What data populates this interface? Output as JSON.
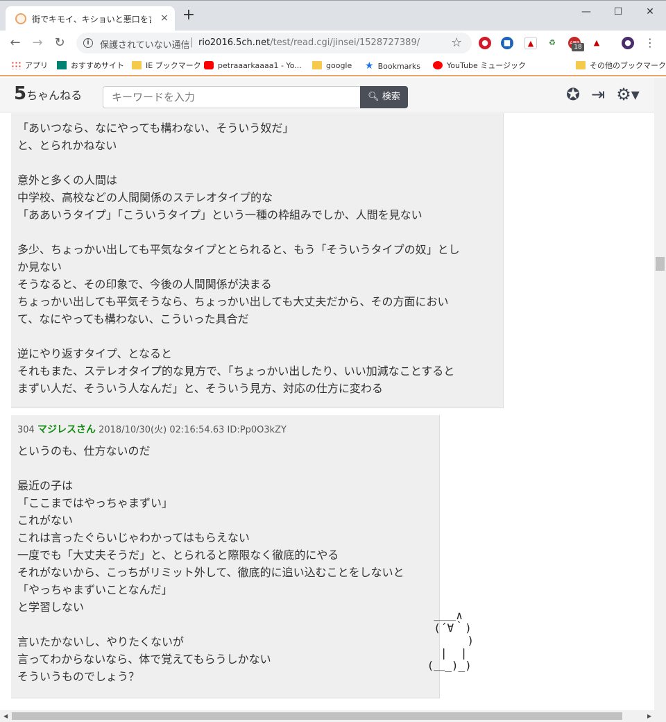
{
  "browser": {
    "tab_title": "街でキモイ、キショいと悪口を言われる",
    "tab_close": "×",
    "new_tab": "+",
    "win_min": "—",
    "win_max": "☐",
    "win_close": "✕",
    "security_text": "保護されていない通信",
    "url_sep": "|",
    "url_host": "rio2016.5ch.net",
    "url_path": "/test/read.cgi/jinsei/1528727389/",
    "ext_badge": "18"
  },
  "bookmarks": [
    {
      "label": "アプリ",
      "icon": "apps-grid-icon"
    },
    {
      "label": "おすすめサイト",
      "icon": "bing-icon"
    },
    {
      "label": "IE ブックマーク",
      "icon": "folder-icon"
    },
    {
      "label": "petraaarkaaaa1 - Yo...",
      "icon": "youtube-icon"
    },
    {
      "label": "google",
      "icon": "folder-icon"
    },
    {
      "label": "Bookmarks",
      "icon": "star-icon"
    },
    {
      "label": "YouTube ミュージック",
      "icon": "youtube-music-icon"
    },
    {
      "label": "その他のブックマーク",
      "icon": "folder-icon"
    }
  ],
  "header": {
    "logo": "5",
    "logo_sub": "ちゃんねる",
    "search_placeholder": "キーワードを入力",
    "search_button": "検索"
  },
  "posts": {
    "continued_body": "「あいつなら、なにやっても構わない、そういう奴だ」\nと、とられかねない\n\n意外と多くの人間は\n中学校、高校などの人間関係のステレオタイプ的な\n「ああいうタイプ」「こういうタイプ」という一種の枠組みでしか、人間を見ない\n\n多少、ちょっかい出しても平気なタイプととられると、もう「そういうタイプの奴」とし\nか見ない\nそうなると、その印象で、今後の人間関係が決まる\nちょっかい出しても平気そうなら、ちょっかい出しても大丈夫だから、その方面におい\nて、なにやっても構わない、こういった具合だ\n\n逆にやり返すタイプ、となると\nそれもまた、ステレオタイプ的な見方で、「ちょっかい出したり、いい加減なことすると\nまずい人だ、そういう人なんだ」と、そういう見方、対応の仕方に変わる",
    "post304": {
      "number": "304",
      "name": "マジレスさん",
      "date": "2018/10/30(火) 02:16:54.63 ID:Pp0O3kZY",
      "body": "というのも、仕方ないのだ\n\n最近の子は\n「ここまではやっちゃまずい」\nこれがない\nこれは言ったぐらいじゃわかってはもらえない\n一度でも「大丈夫そうだ」と、とられると際限なく徹底的にやる\nそれがないから、こっちがリミット外して、徹底的に追い込むことをしないと\n「やっちゃまずいことなんだ」\nと学習しない\n\n言いたかないし、やりたくないが\n言ってわからないなら、体で覚えてもらうしかない\nそういうものでしょう？"
    }
  },
  "ascii_art": "  ＿＿∧\n  (´∀｀)\n       )\n   |  |\n (＿_)_)"
}
